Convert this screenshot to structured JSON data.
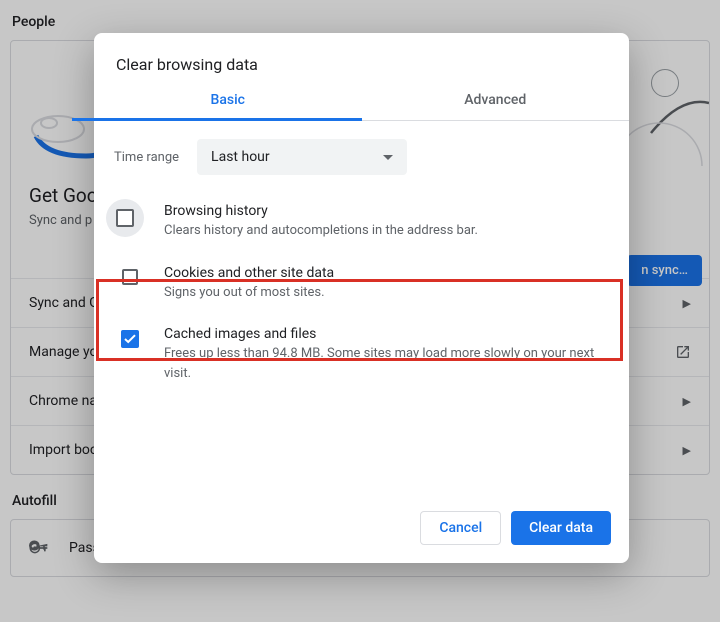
{
  "bg": {
    "section_people": "People",
    "hero_heading": "Get Goo",
    "hero_sub": "Sync and p",
    "l_line": "L",
    "li_line": "li",
    "sync_btn": "n sync…",
    "row_sync": "Sync and G",
    "row_manage": "Manage yo",
    "row_chromename": "Chrome na",
    "row_import": "Import boo",
    "section_autofill": "Autofill",
    "row_passwords": "Passwords"
  },
  "dialog": {
    "title": "Clear browsing data",
    "tabs": {
      "basic": "Basic",
      "advanced": "Advanced"
    },
    "timerange": {
      "label": "Time range",
      "value": "Last hour"
    },
    "options": [
      {
        "title": "Browsing history",
        "sub": "Clears history and autocompletions in the address bar.",
        "checked": false
      },
      {
        "title": "Cookies and other site data",
        "sub": "Signs you out of most sites.",
        "checked": false
      },
      {
        "title": "Cached images and files",
        "sub": "Frees up less than 94.8 MB. Some sites may load more slowly on your next visit.",
        "checked": true
      }
    ],
    "buttons": {
      "cancel": "Cancel",
      "clear": "Clear data"
    }
  }
}
